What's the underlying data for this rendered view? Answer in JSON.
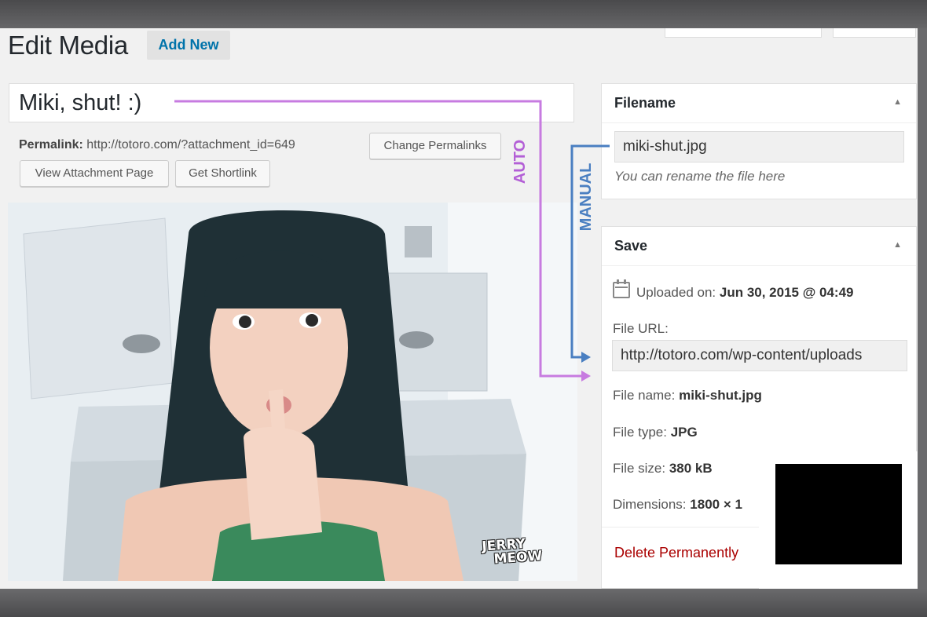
{
  "header": {
    "page_title": "Edit Media",
    "add_new_label": "Add New"
  },
  "media": {
    "title": "Miki, shut! :)",
    "permalink_label": "Permalink:",
    "permalink_url": "http://totoro.com/?attachment_id=649",
    "change_permalinks_label": "Change Permalinks",
    "view_attachment_label": "View Attachment Page",
    "get_shortlink_label": "Get Shortlink",
    "watermark_top": "JERRY",
    "watermark_bottom": "MEOW"
  },
  "filename_panel": {
    "title": "Filename",
    "value": "miki-shut.jpg",
    "hint": "You can rename the file here"
  },
  "save_panel": {
    "title": "Save",
    "uploaded_label": "Uploaded on:",
    "uploaded_value": "Jun 30, 2015 @ 04:49",
    "file_url_label": "File URL:",
    "file_url_value": "http://totoro.com/wp-content/uploads",
    "file_name_label": "File name:",
    "file_name_value": "miki-shut.jpg",
    "file_type_label": "File type:",
    "file_type_value": "JPG",
    "file_size_label": "File size:",
    "file_size_value": "380 kB",
    "dimensions_label": "Dimensions:",
    "dimensions_value": "1800 × 1",
    "delete_label": "Delete Permanently"
  },
  "annotations": {
    "auto_label": "AUTO",
    "manual_label": "MANUAL",
    "auto_color": "#c77be0",
    "manual_color": "#4a7fc1"
  },
  "colors": {
    "link_blue": "#0073aa",
    "delete_red": "#aa0000"
  }
}
